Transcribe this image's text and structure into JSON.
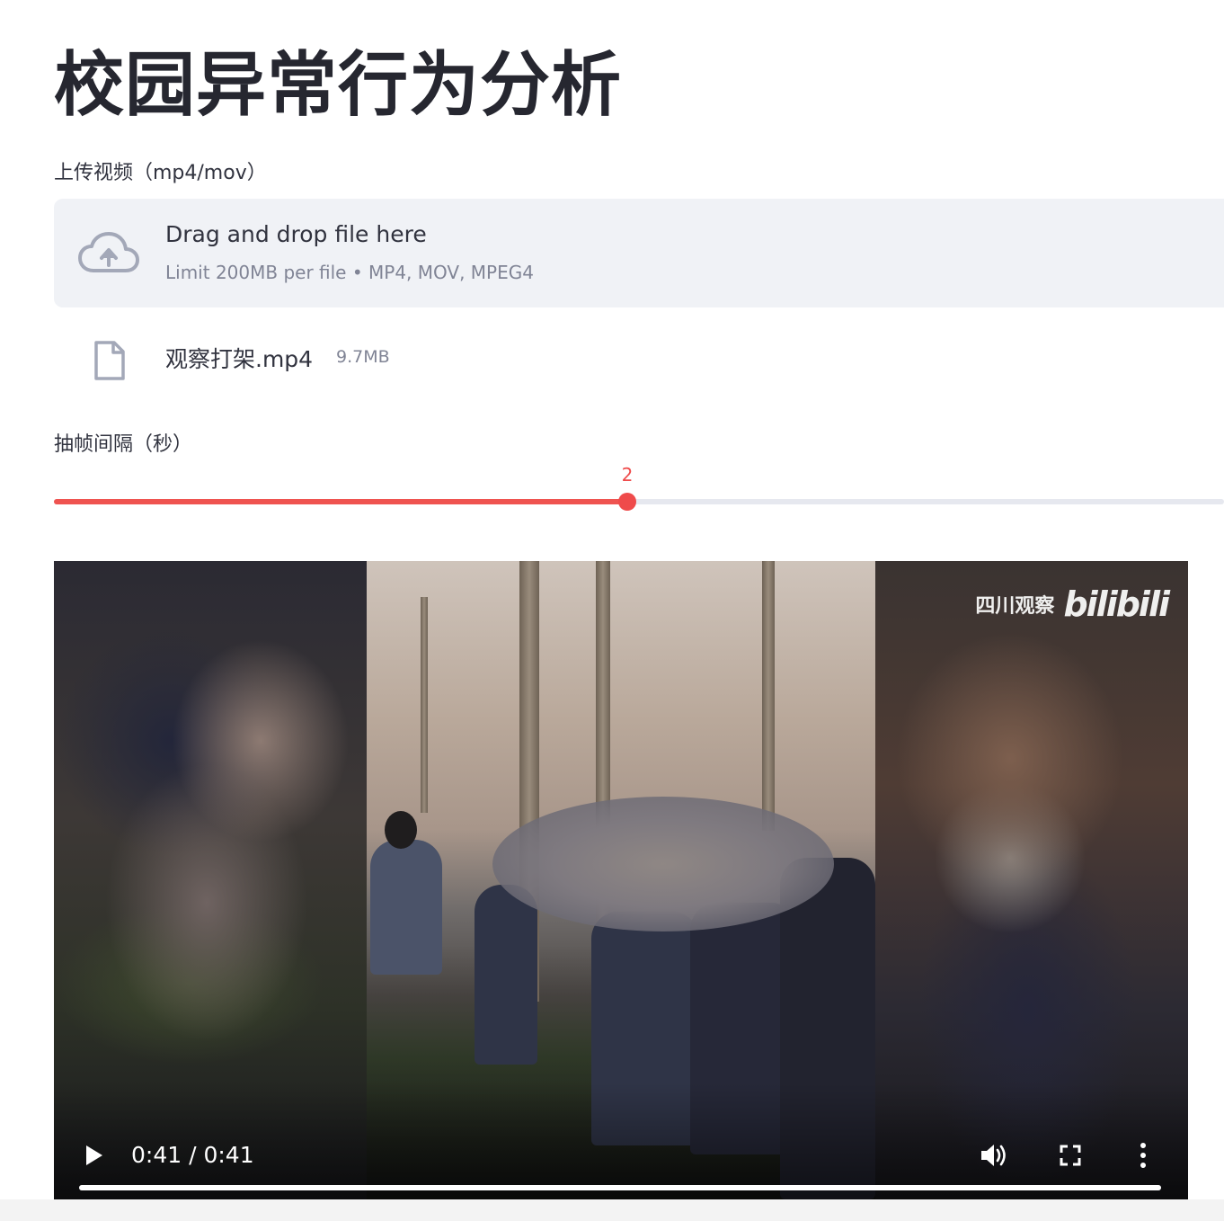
{
  "title": "校园异常行为分析",
  "uploader": {
    "label": "上传视频（mp4/mov）",
    "dropzone_title": "Drag and drop file here",
    "dropzone_limit": "Limit 200MB per file • MP4, MOV, MPEG4",
    "icon": "cloud-upload-icon"
  },
  "uploaded_file": {
    "name": "观察打架.mp4",
    "size": "9.7MB",
    "icon": "file-icon"
  },
  "slider": {
    "label": "抽帧间隔（秒）",
    "value": "2",
    "fraction": 0.49,
    "accent_color": "#ef4b4b"
  },
  "video": {
    "watermark_text": "四川观察",
    "watermark_logo": "bilibili",
    "time": "0:41 / 0:41",
    "progress": 1.0,
    "controls": [
      "play-icon",
      "volume-icon",
      "fullscreen-icon",
      "more-options-icon"
    ]
  }
}
